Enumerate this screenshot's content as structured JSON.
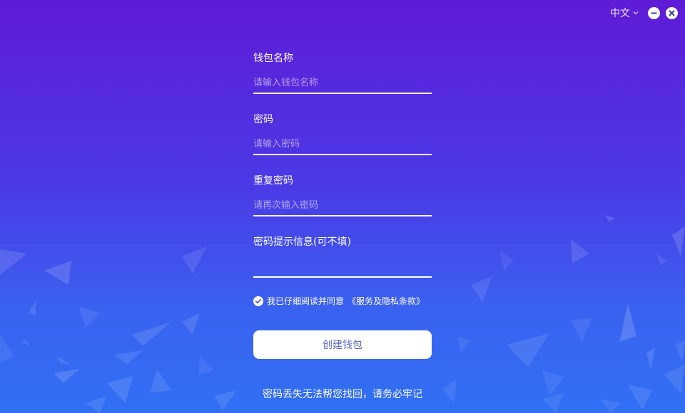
{
  "header": {
    "language": "中文"
  },
  "form": {
    "wallet_name": {
      "label": "钱包名称",
      "placeholder": "请输入钱包名称",
      "value": ""
    },
    "password": {
      "label": "密码",
      "placeholder": "请输入密码",
      "value": ""
    },
    "repeat_password": {
      "label": "重复密码",
      "placeholder": "请再次输入密码",
      "value": ""
    },
    "hint": {
      "label": "密码提示信息(可不填)",
      "placeholder": "",
      "value": ""
    }
  },
  "agreement": {
    "checked": true,
    "text": "我已仔细阅读并同意",
    "link": "《服务及隐私条款》"
  },
  "actions": {
    "create_label": "创建钱包"
  },
  "footer": {
    "warning": "密码丢失无法帮您找回，请务必牢记"
  },
  "colors": {
    "background_top": "#5f1bd6",
    "background_bottom": "#3070f4",
    "button_text": "#5a6bc8",
    "control_icon": "#3b3f9a"
  },
  "icons": {
    "language_chevron": "chevron-down-icon",
    "minimize": "minimize-icon",
    "close": "close-icon",
    "agree_check": "check-icon"
  }
}
